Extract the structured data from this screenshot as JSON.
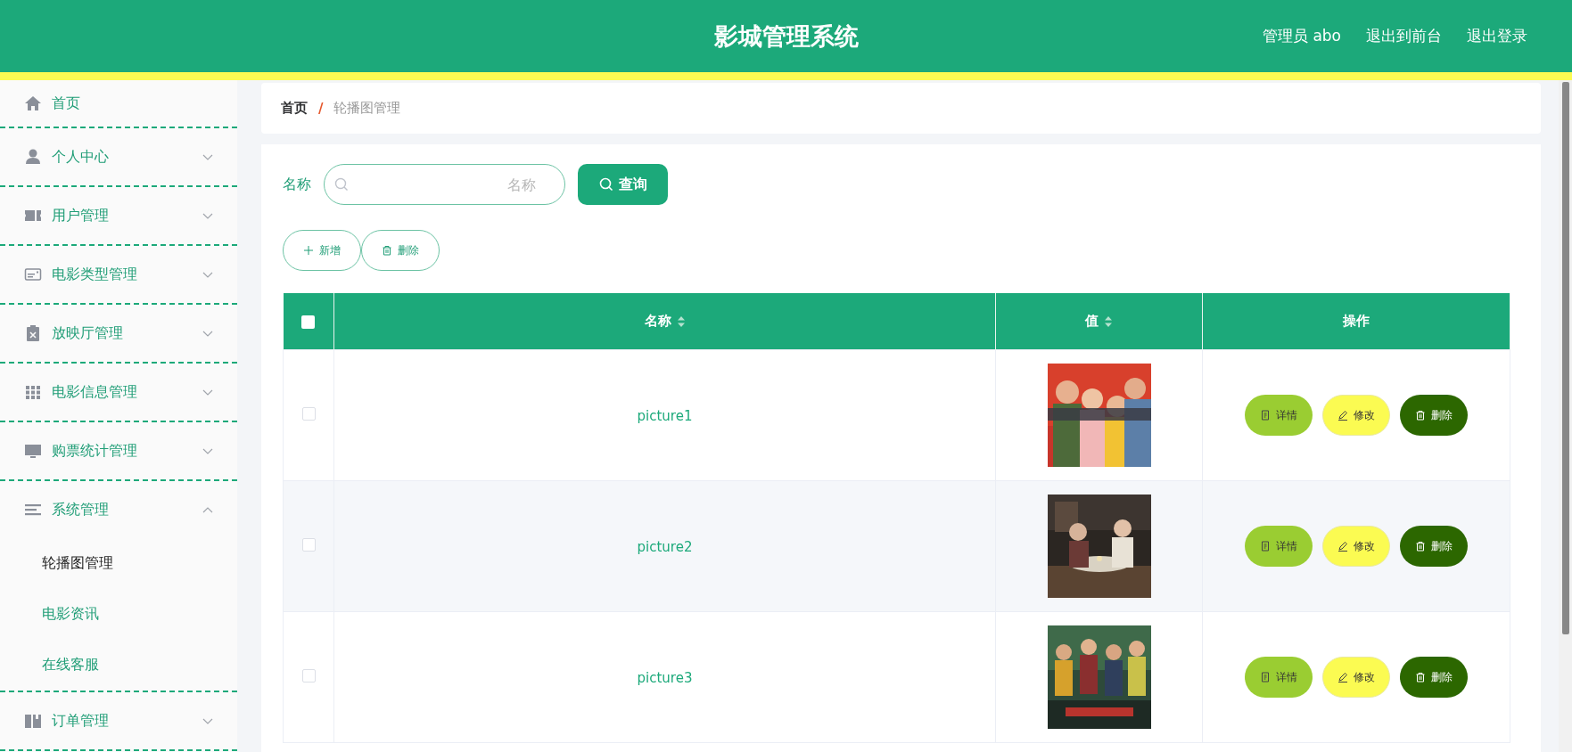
{
  "header": {
    "title": "影城管理系统",
    "links": [
      "管理员 abo",
      "退出到前台",
      "退出登录"
    ]
  },
  "sidebar": {
    "items": [
      {
        "label": "首页",
        "kind": "home"
      },
      {
        "label": "个人中心",
        "kind": "user",
        "expanded": false
      },
      {
        "label": "用户管理",
        "kind": "ticket",
        "expanded": false
      },
      {
        "label": "电影类型管理",
        "kind": "card",
        "expanded": false
      },
      {
        "label": "放映厅管理",
        "kind": "clipboard",
        "expanded": false
      },
      {
        "label": "电影信息管理",
        "kind": "grid",
        "expanded": false
      },
      {
        "label": "购票统计管理",
        "kind": "monitor",
        "expanded": false
      },
      {
        "label": "系统管理",
        "kind": "lines",
        "expanded": true,
        "children": [
          {
            "label": "轮播图管理",
            "selected": true
          },
          {
            "label": "电影资讯",
            "selected": false
          },
          {
            "label": "在线客服",
            "selected": false
          }
        ]
      },
      {
        "label": "订单管理",
        "kind": "building",
        "expanded": false
      }
    ]
  },
  "breadcrumb": {
    "items": [
      "首页",
      "轮播图管理"
    ],
    "separator": "/"
  },
  "search": {
    "label": "名称",
    "placeholder": "名称",
    "button": "查询"
  },
  "toolbar": [
    {
      "kind": "add",
      "label": "新增"
    },
    {
      "kind": "delete",
      "label": "删除"
    }
  ],
  "table": {
    "all_checked": false,
    "columns": [
      {
        "label": "名称",
        "sortable": true
      },
      {
        "label": "值",
        "sortable": true
      },
      {
        "label": "操作",
        "sortable": false
      }
    ],
    "rows": [
      {
        "name": "picture1",
        "checked": false,
        "actions": [
          {
            "kind": "detail",
            "label": "详情"
          },
          {
            "kind": "edit",
            "label": "修改"
          },
          {
            "kind": "delete",
            "label": "删除"
          }
        ]
      },
      {
        "name": "picture2",
        "checked": false,
        "actions": [
          {
            "kind": "detail",
            "label": "详情"
          },
          {
            "kind": "edit",
            "label": "修改"
          },
          {
            "kind": "delete",
            "label": "删除"
          }
        ]
      },
      {
        "name": "picture3",
        "checked": false,
        "actions": [
          {
            "kind": "detail",
            "label": "详情"
          },
          {
            "kind": "edit",
            "label": "修改"
          },
          {
            "kind": "delete",
            "label": "删除"
          }
        ]
      }
    ]
  }
}
